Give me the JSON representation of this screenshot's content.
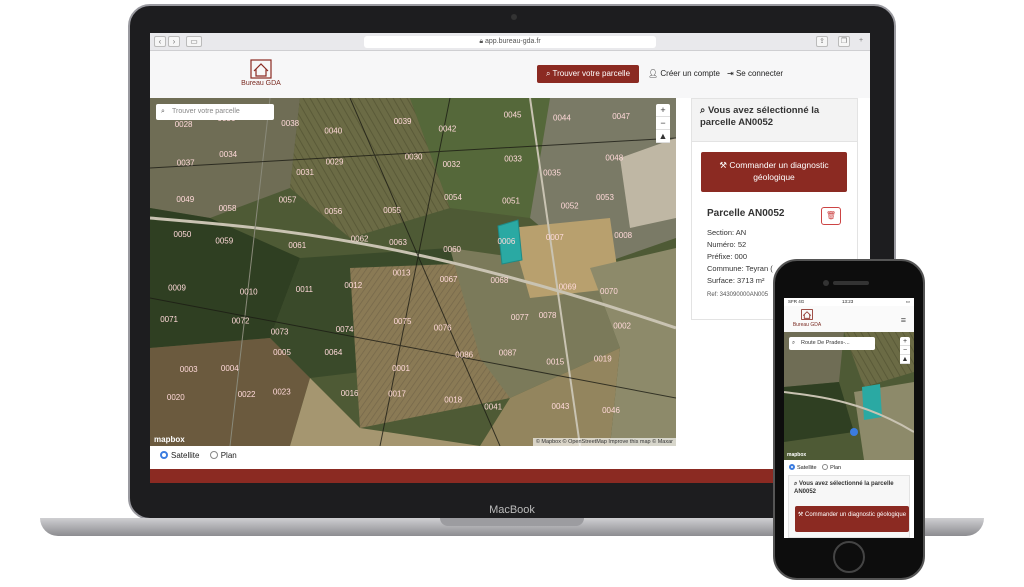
{
  "browser": {
    "url": "app.bureau-gda.fr"
  },
  "header": {
    "brand": "Bureau GDA",
    "find_button": "Trouver votre parcelle",
    "create_account": "Créer un compte",
    "login": "Se connecter"
  },
  "map": {
    "search_placeholder": "Trouver votre parcelle",
    "attribution": "© Mapbox © OpenStreetMap Improve this map © Maxar",
    "mapbox_logo": "mapbox",
    "parcel_labels": [
      "0028",
      "0036",
      "0038",
      "0040",
      "0039",
      "0042",
      "0045",
      "0044",
      "0047",
      "0037",
      "0034",
      "0031",
      "0029",
      "0030",
      "0032",
      "0033",
      "0035",
      "0048",
      "0049",
      "0058",
      "0057",
      "0056",
      "0055",
      "0054",
      "0051",
      "0052",
      "0053",
      "0050",
      "0059",
      "0061",
      "0062",
      "0063",
      "0060",
      "0006",
      "0007",
      "0008",
      "0009",
      "0010",
      "0011",
      "0012",
      "0013",
      "0067",
      "0068",
      "0069",
      "0070",
      "0071",
      "0072",
      "0073",
      "0074",
      "0075",
      "0076",
      "0077",
      "0078",
      "0002",
      "0003",
      "0004",
      "0005",
      "0064",
      "0001",
      "0086",
      "0087",
      "0015",
      "0019",
      "0020",
      "0022",
      "0023",
      "0016",
      "0017",
      "0018",
      "0041",
      "0043",
      "0046"
    ],
    "selected_parcel": "0052"
  },
  "layer_toggle": {
    "satellite": "Satellite",
    "plan": "Plan",
    "selected": "satellite"
  },
  "panel": {
    "selected_title": "Vous avez sélectionné la parcelle AN0052",
    "order_button": "Commander un diagnostic géologique",
    "parcel_title": "Parcelle AN0052",
    "section": "Section: AN",
    "numero": "Numéro: 52",
    "prefixe": "Préfixe: 000",
    "commune": "Commune: Teyran (",
    "surface": "Surface: 3713 m²",
    "ref": "Ref: 343090000AN005"
  },
  "laptop": {
    "brand": "MacBook"
  },
  "phone": {
    "status_left": "SFR 4G",
    "status_time": "13:23",
    "brand": "Bureau GDA",
    "search_value": "Route De Prades-...",
    "satellite": "Satellite",
    "plan": "Plan",
    "selected_title": "Vous avez sélectionné la parcelle AN0052",
    "order_button": "Commander un diagnostic géologique",
    "mapbox_logo": "mapbox"
  },
  "colors": {
    "brand": "#8b2a22",
    "selected_parcel": "#2aa9a3",
    "radio_active": "#3b7ce0"
  }
}
